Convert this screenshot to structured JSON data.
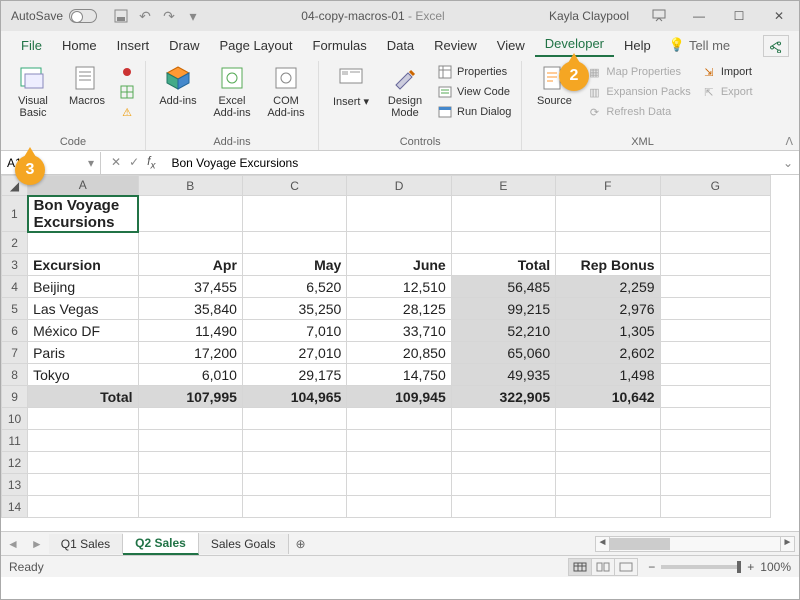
{
  "titlebar": {
    "autosave": "AutoSave",
    "filename": "04-copy-macros-01",
    "app": "Excel",
    "user": "Kayla Claypool"
  },
  "menu": {
    "file": "File",
    "home": "Home",
    "insert": "Insert",
    "draw": "Draw",
    "pagelayout": "Page Layout",
    "formulas": "Formulas",
    "data": "Data",
    "review": "Review",
    "view": "View",
    "developer": "Developer",
    "help": "Help",
    "tellme": "Tell me"
  },
  "ribbon": {
    "visualbasic": "Visual Basic",
    "macros": "Macros",
    "addins": "Add-ins",
    "exceladdins": "Excel Add-ins",
    "comaddins": "COM Add-ins",
    "insert": "Insert",
    "designmode": "Design Mode",
    "properties": "Properties",
    "viewcode": "View Code",
    "rundialog": "Run Dialog",
    "source": "Source",
    "mapprops": "Map Properties",
    "exppacks": "Expansion Packs",
    "refresh": "Refresh Data",
    "import": "Import",
    "export": "Export",
    "g_code": "Code",
    "g_addins": "Add-ins",
    "g_controls": "Controls",
    "g_xml": "XML"
  },
  "namebox": {
    "cell": "A1",
    "formula": "Bon Voyage Excursions"
  },
  "cols": [
    "A",
    "B",
    "C",
    "D",
    "E",
    "F",
    "G"
  ],
  "data": {
    "title": "Bon Voyage Excursions",
    "headers": [
      "Excursion",
      "Apr",
      "May",
      "June",
      "Total",
      "Rep Bonus"
    ],
    "rows": [
      [
        "Beijing",
        "37,455",
        "6,520",
        "12,510",
        "56,485",
        "2,259"
      ],
      [
        "Las Vegas",
        "35,840",
        "35,250",
        "28,125",
        "99,215",
        "2,976"
      ],
      [
        "México DF",
        "11,490",
        "7,010",
        "33,710",
        "52,210",
        "1,305"
      ],
      [
        "Paris",
        "17,200",
        "27,010",
        "20,850",
        "65,060",
        "2,602"
      ],
      [
        "Tokyo",
        "6,010",
        "29,175",
        "14,750",
        "49,935",
        "1,498"
      ]
    ],
    "totals": [
      "Total",
      "107,995",
      "104,965",
      "109,945",
      "322,905",
      "10,642"
    ]
  },
  "sheets": {
    "s1": "Q1 Sales",
    "s2": "Q2 Sales",
    "s3": "Sales Goals"
  },
  "status": {
    "ready": "Ready",
    "zoom": "100%"
  },
  "callouts": {
    "c2": "2",
    "c3": "3"
  }
}
